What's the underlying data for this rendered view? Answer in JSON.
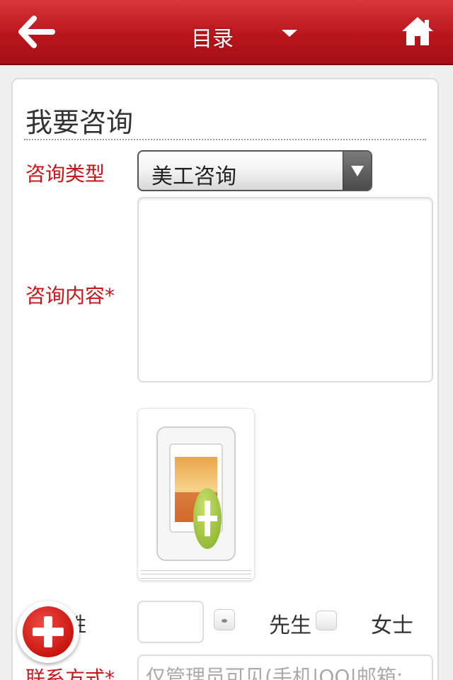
{
  "header": {
    "title": "目录",
    "back_icon": "arrow-left-icon",
    "menu_icon": "caret-down-icon",
    "home_icon": "home-icon"
  },
  "form": {
    "title": "我要咨询",
    "type_label": "咨询类型",
    "type_value": "美工咨询",
    "content_label": "咨询内容*",
    "content_value": "",
    "upload_icon": "add-image-icon",
    "name_label": "姓",
    "title_option_1": "先生",
    "title_option_2": "女士",
    "contact_label": "联系方式*",
    "contact_placeholder": "仅管理员可见(手机|QQ|邮箱:"
  },
  "colors": {
    "header_red": "#b8161c",
    "label_red": "#c7161c",
    "fab_red": "#d81e16"
  },
  "fab": {
    "icon": "plus-icon"
  }
}
